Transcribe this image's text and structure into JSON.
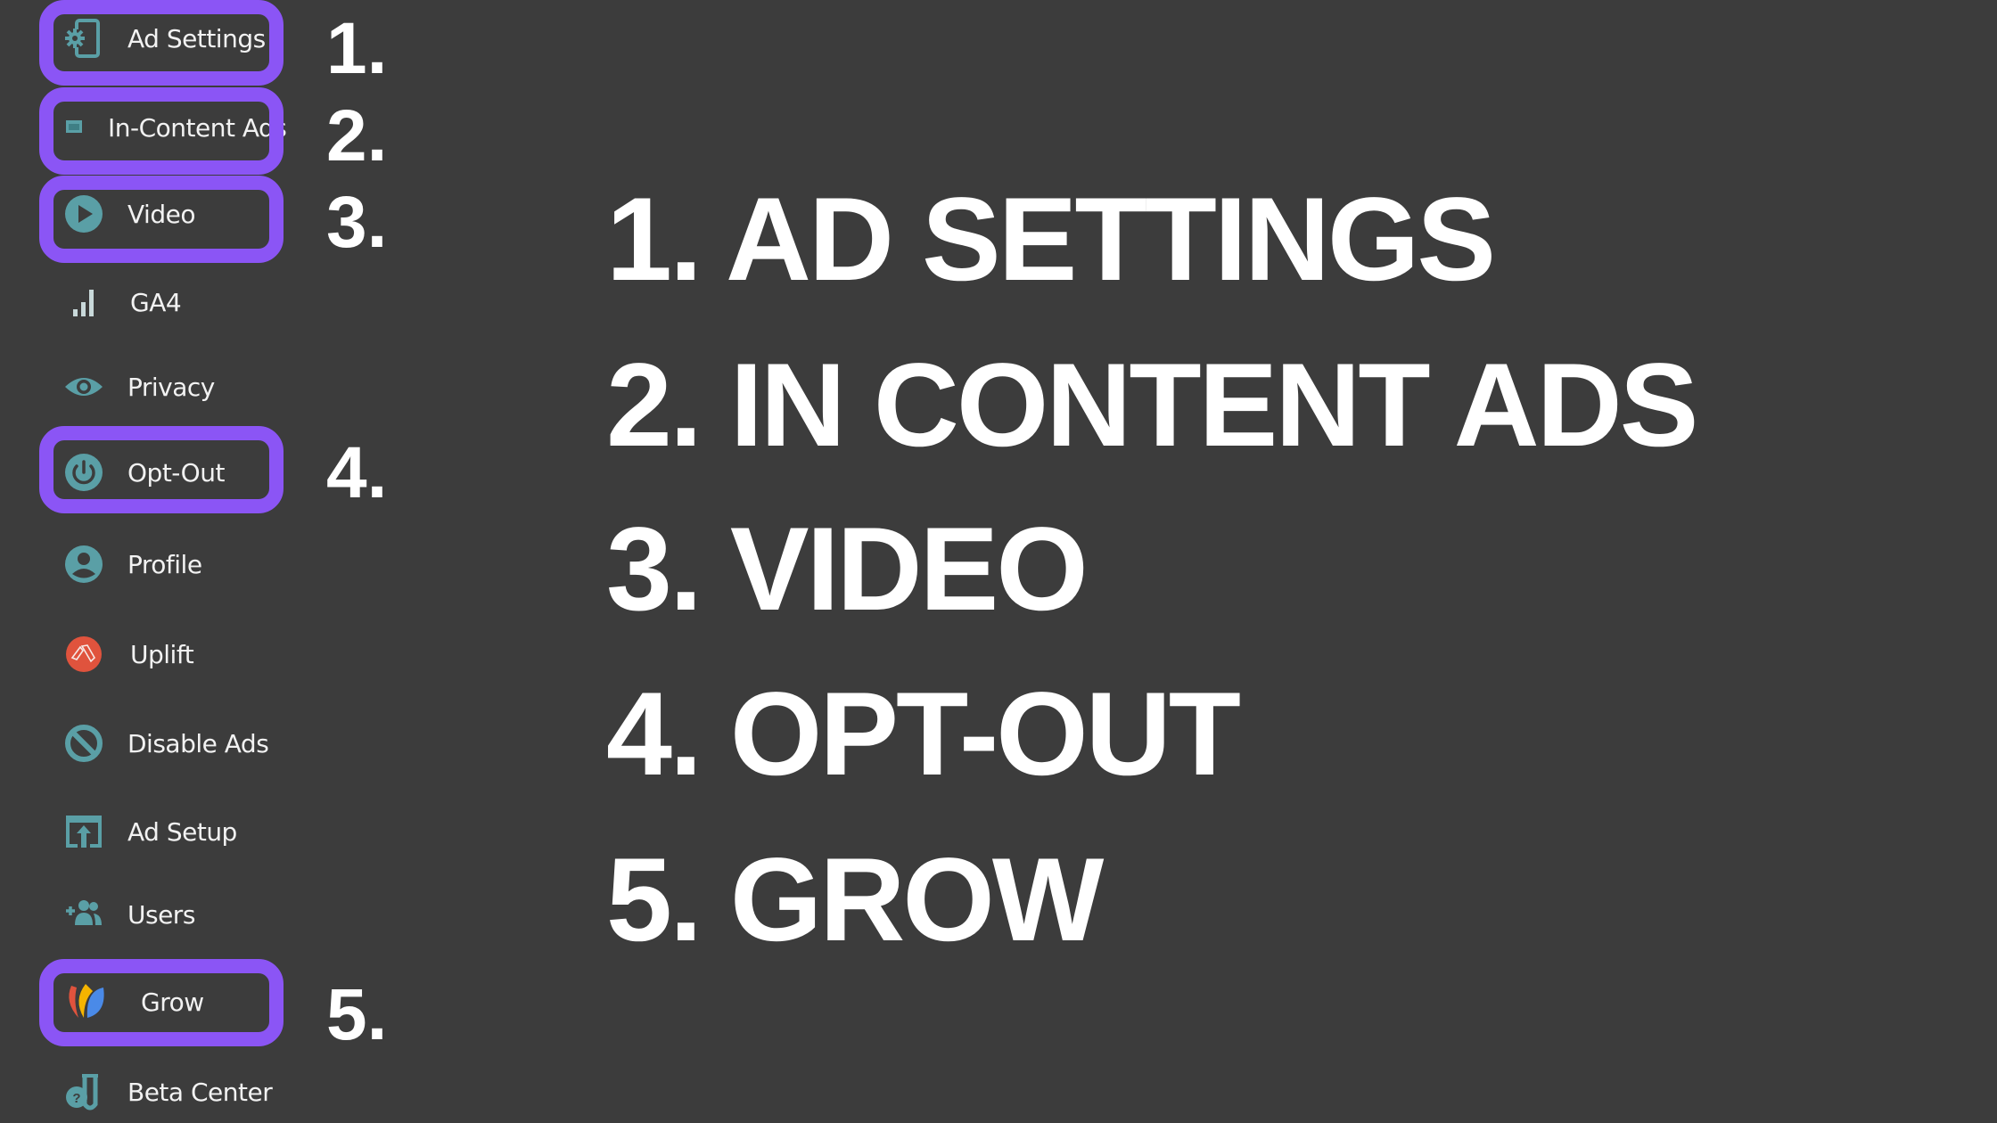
{
  "sidebar": {
    "items": [
      {
        "label": "Ad Settings",
        "icon": "ad-settings-icon",
        "highlighted": true
      },
      {
        "label": "In-Content Ads",
        "icon": "in-content-ads-icon",
        "highlighted": true
      },
      {
        "label": "Video",
        "icon": "play-icon",
        "highlighted": true
      },
      {
        "label": "GA4",
        "icon": "bar-chart-icon",
        "highlighted": false
      },
      {
        "label": "Privacy",
        "icon": "eye-icon",
        "highlighted": false
      },
      {
        "label": "Opt-Out",
        "icon": "power-icon",
        "highlighted": true
      },
      {
        "label": "Profile",
        "icon": "user-icon",
        "highlighted": false
      },
      {
        "label": "Uplift",
        "icon": "uplift-icon",
        "highlighted": false
      },
      {
        "label": "Disable Ads",
        "icon": "block-icon",
        "highlighted": false
      },
      {
        "label": "Ad Setup",
        "icon": "upload-screen-icon",
        "highlighted": false
      },
      {
        "label": "Users",
        "icon": "add-users-icon",
        "highlighted": false
      },
      {
        "label": "Grow",
        "icon": "grow-logo-icon",
        "highlighted": true
      },
      {
        "label": "Beta Center",
        "icon": "beta-flask-icon",
        "highlighted": false
      }
    ]
  },
  "markers": [
    "1.",
    "2.",
    "3.",
    "4.",
    "5."
  ],
  "headlines": [
    "1. AD SETTINGS",
    "2. IN CONTENT ADS",
    "3. VIDEO",
    "4. OPT-OUT",
    "5. GROW"
  ],
  "colors": {
    "background": "#3c3c3c",
    "highlight": "#8b55f5",
    "icon_teal": "#5a9fa6",
    "uplift_red": "#e0533d",
    "text": "#ffffff"
  }
}
